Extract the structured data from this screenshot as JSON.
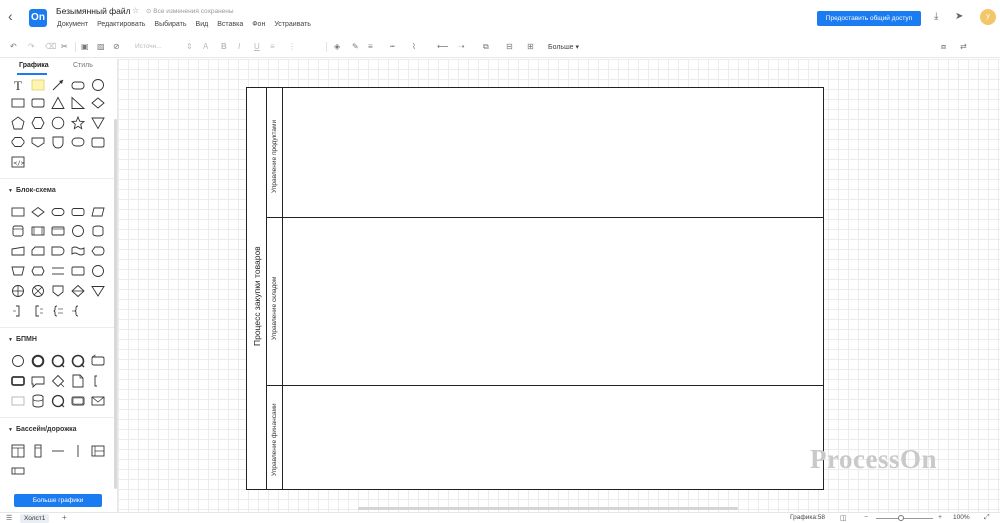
{
  "app": {
    "file_title": "Безымянный файл",
    "save_status": "Все изменения сохранены",
    "logo_text": "On",
    "share_label": "Предоставить общий доступ",
    "avatar_letter": "y"
  },
  "menu": [
    "Документ",
    "Редактировать",
    "Выбирать",
    "Вид",
    "Вставка",
    "Фон",
    "Устраивать"
  ],
  "toolbar": {
    "font_placeholder": "Источн...",
    "more_label": "Больше"
  },
  "sidebar": {
    "tabs": [
      "Графика",
      "Стиль"
    ],
    "sections": [
      "Блок-схема",
      "БПМН",
      "Бассейн/дорожка"
    ],
    "more_shapes_label": "Больше графики"
  },
  "diagram": {
    "pool_title": "Процесс закупки товаров",
    "lanes": [
      "Управление продуктами",
      "Управление складом",
      "Управление финансами"
    ]
  },
  "watermark": "ProcessOn",
  "status": {
    "canvas_tab": "Холст1",
    "shape_count_label": "Графика:58",
    "zoom": "100%"
  },
  "colors": {
    "accent": "#1a7cf0",
    "grid": "#ececec",
    "diagram_stroke": "#222222"
  }
}
